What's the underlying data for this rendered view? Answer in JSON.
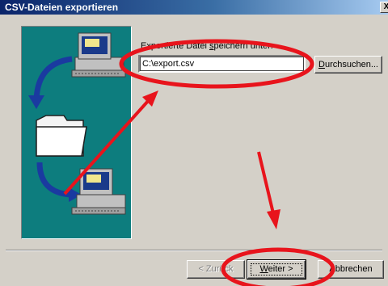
{
  "window": {
    "title": "CSV-Dateien exportieren",
    "close_glyph": "X"
  },
  "form": {
    "label_prefix": "Exportierte Datei ",
    "label_access": "s",
    "label_suffix": "peichern unter:",
    "path_value": "C:\\export.csv",
    "browse_access": "D",
    "browse_rest": "urchsuchen..."
  },
  "buttons": {
    "back_label": "< Zurück",
    "next_access": "W",
    "next_rest": "eiter >",
    "cancel_label": "Abbrechen"
  },
  "icons": {
    "close": "close-icon",
    "computer": "computer-icon",
    "folder": "folder-icon",
    "arrow": "arrow-icon"
  },
  "colors": {
    "panel": "#0d7d7e",
    "annotation": "#e8141c"
  }
}
